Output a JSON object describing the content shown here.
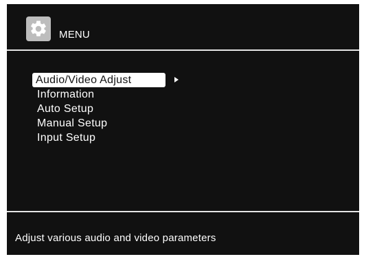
{
  "header": {
    "title": "MENU",
    "icon": "gear-icon"
  },
  "menu": {
    "items": [
      {
        "label": "Audio/Video Adjust",
        "selected": true
      },
      {
        "label": "Information",
        "selected": false
      },
      {
        "label": "Auto Setup",
        "selected": false
      },
      {
        "label": "Manual Setup",
        "selected": false
      },
      {
        "label": "Input Setup",
        "selected": false
      }
    ],
    "submenu_indicator": "arrow-right-icon"
  },
  "footer": {
    "description": "Adjust various audio and video parameters"
  },
  "colors": {
    "background": "#111111",
    "text": "#ffffff",
    "highlight": "#ffffff",
    "icon_bg": "#bdbdbd"
  }
}
